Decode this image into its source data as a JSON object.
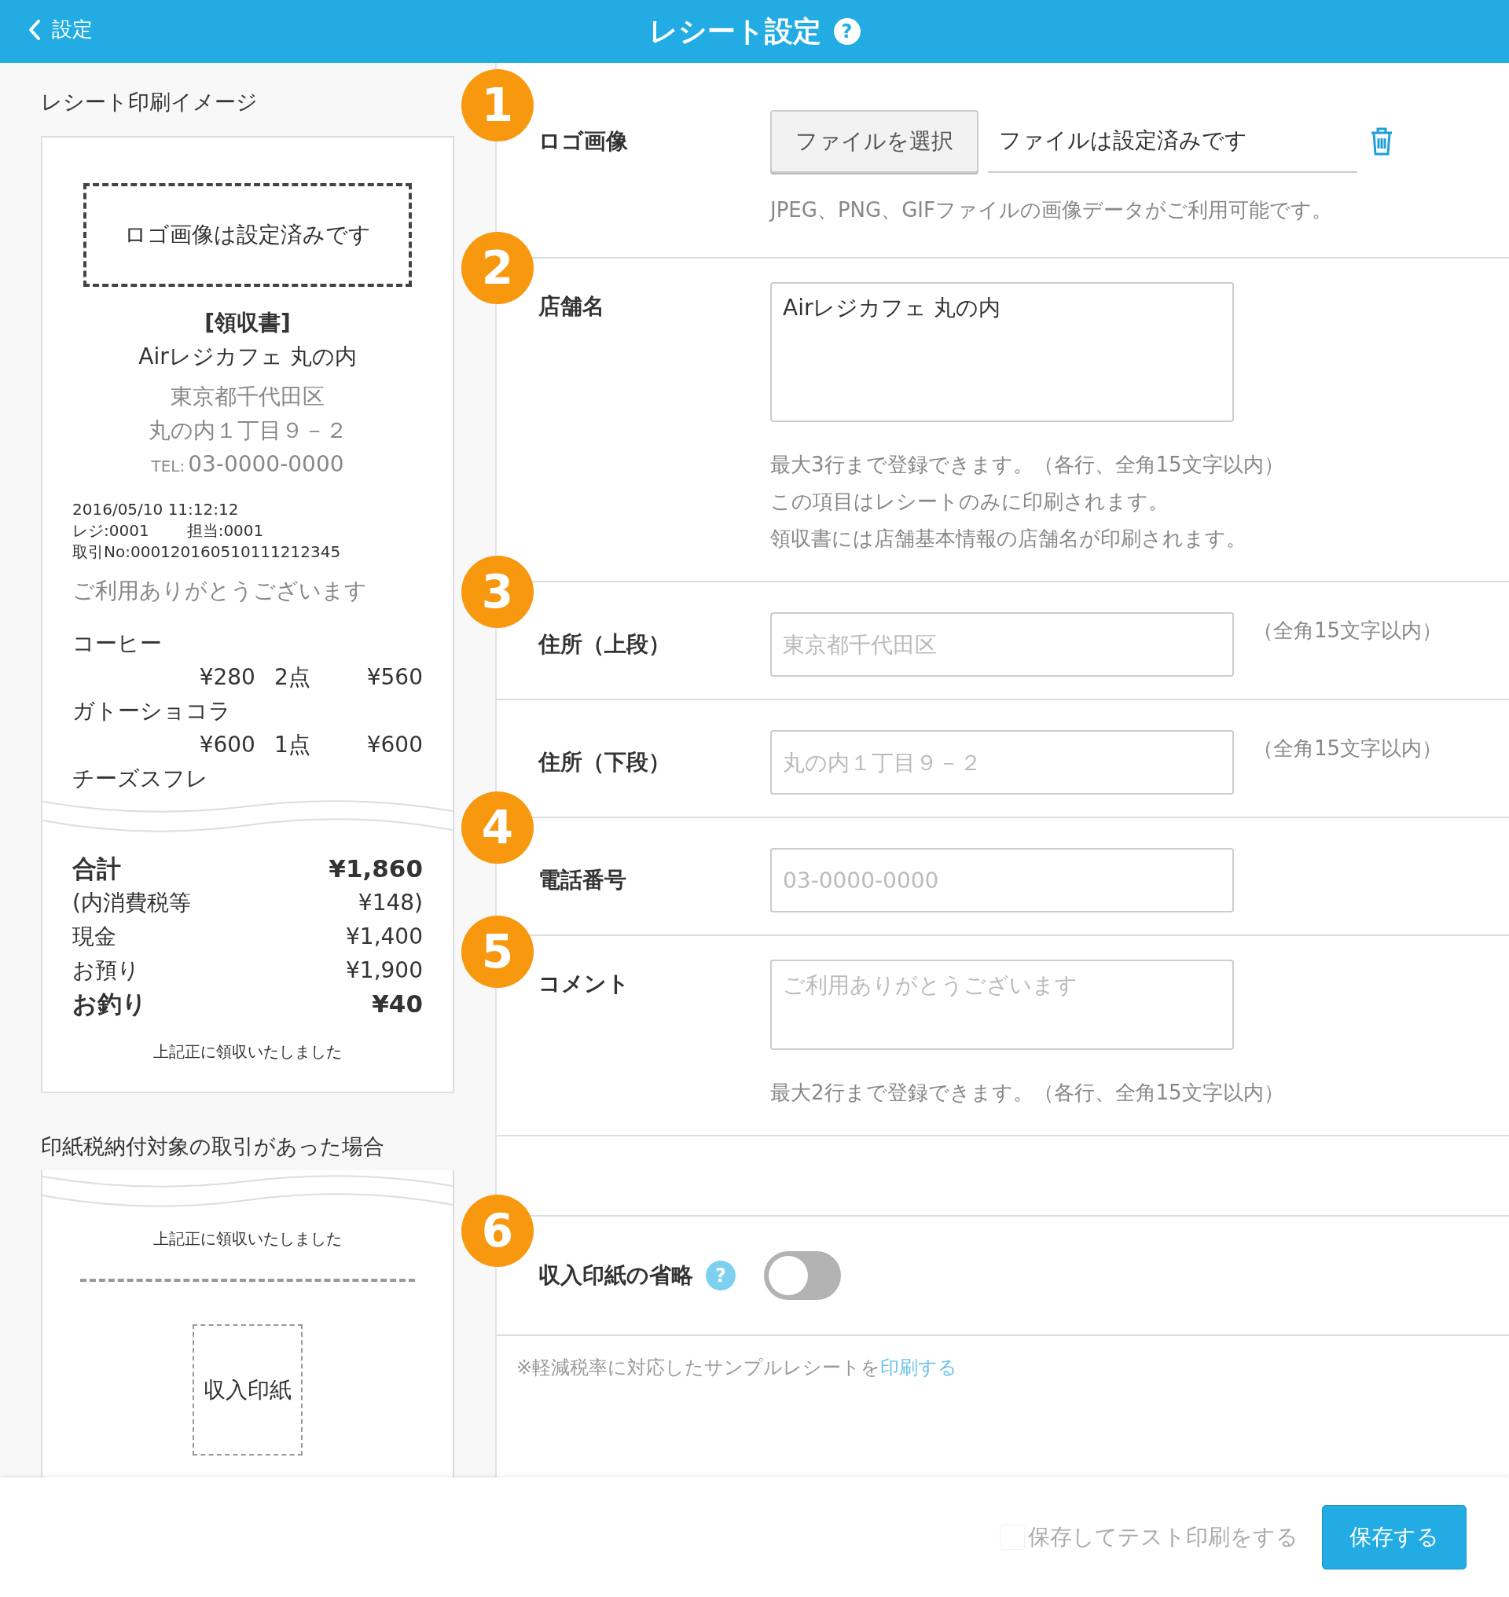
{
  "header": {
    "back_label": "設定",
    "title": "レシート設定",
    "help": "?"
  },
  "preview": {
    "title": "レシート印刷イメージ",
    "logo_text": "ロゴ画像は設定済みです",
    "receipt_heading": "[領収書]",
    "shop_name": "Airレジカフェ 丸の内",
    "address_lines": [
      "東京都千代田区",
      "丸の内１丁目９－２"
    ],
    "tel_label": "TEL:",
    "tel": "03-0000-0000",
    "datetime": "2016/05/10 11:12:12",
    "register": "レジ:0001",
    "staff": "担当:0001",
    "transaction": "取引No:000120160510111212345",
    "comment": "ご利用ありがとうございます",
    "items": [
      {
        "name": "コーヒー",
        "price": "¥280",
        "qty": "2点",
        "amount": "¥560"
      },
      {
        "name": "ガトーショコラ",
        "price": "¥600",
        "qty": "1点",
        "amount": "¥600"
      },
      {
        "name": "チーズスフレ"
      }
    ],
    "totals": [
      {
        "label": "合計",
        "value": "¥1,860",
        "bold": true
      },
      {
        "label": "(内消費税等",
        "value": "¥148)",
        "bold": false
      },
      {
        "label": "現金",
        "value": "¥1,400",
        "bold": false
      },
      {
        "label": "お預り",
        "value": "¥1,900",
        "bold": false
      },
      {
        "label": "お釣り",
        "value": "¥40",
        "bold": true
      }
    ],
    "received": "上記正に領収いたしました"
  },
  "stamp_preview": {
    "title": "印紙税納付対象の取引があった場合",
    "received": "上記正に領収いたしました",
    "stamp_label": "収入印紙"
  },
  "sections": [
    {
      "kind": "file",
      "number": "1",
      "label": "ロゴ画像",
      "button": "ファイルを選択",
      "file_status": "ファイルは設定済みです",
      "hints": [
        "JPEG、PNG、GIFファイルの画像データがご利用可能です。"
      ]
    },
    {
      "kind": "textarea",
      "number": "2",
      "label": "店舗名",
      "value": "Airレジカフェ 丸の内",
      "hints": [
        "最大3行まで登録できます。（各行、全角15文字以内）",
        "この項目はレシートのみに印刷されます。",
        "領収書には店舗基本情報の店舗名が印刷されます。"
      ]
    },
    {
      "kind": "input",
      "number": "3",
      "label": "住所（上段）",
      "placeholder": "東京都千代田区",
      "note": "（全角15文字以内）"
    },
    {
      "kind": "input",
      "label": "住所（下段）",
      "placeholder": "丸の内１丁目９－２",
      "note": "（全角15文字以内）"
    },
    {
      "kind": "input",
      "number": "4",
      "label": "電話番号",
      "placeholder": "03-0000-0000"
    },
    {
      "kind": "textarea",
      "number": "5",
      "label": "コメント",
      "placeholder": "ご利用ありがとうございます",
      "hints": [
        "最大2行まで登録できます。（各行、全角15文字以内）"
      ]
    },
    {
      "kind": "spacer"
    },
    {
      "kind": "toggle",
      "number": "6",
      "label": "収入印紙の省略",
      "help": "?",
      "on": false
    }
  ],
  "sample_note": {
    "text": "※軽減税率に対応したサンプルレシートを",
    "link": "印刷する"
  },
  "footer": {
    "test_print": {
      "label": "保存してテスト印刷をする",
      "checked": false,
      "disabled": true
    },
    "save": "保存する"
  }
}
